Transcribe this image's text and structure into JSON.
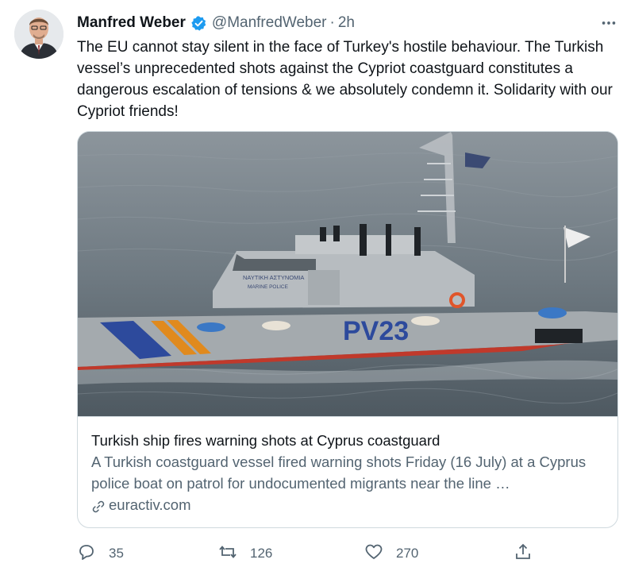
{
  "author": {
    "name": "Manfred Weber",
    "handle": "@ManfredWeber",
    "separator": "·",
    "time": "2h"
  },
  "tweet": {
    "text": "The EU cannot stay silent in the face of Turkey's hostile behaviour. The Turkish vessel’s unprecedented shots against the Cypriot coastguard constitutes a dangerous escalation of tensions & we absolutely condemn it. Solidarity with our Cypriot friends!"
  },
  "card": {
    "title": "Turkish ship fires warning shots at Cyprus coastguard",
    "description": "A Turkish coastguard vessel fired warning shots Friday (16 July) at a Cyprus police boat on patrol for undocumented migrants near the line …",
    "domain": "euractiv.com",
    "image": {
      "hull_text": "PV23",
      "cabin_text_1": "ΝΑΥΤΙΚΗ ΑΣΤΥΝΟΜΙΑ",
      "cabin_text_2": "MARINE POLICE"
    }
  },
  "actions": {
    "replies": "35",
    "retweets": "126",
    "likes": "270"
  },
  "colors": {
    "verified": "#1d9bf0",
    "text_secondary": "#536471",
    "border": "#cfd9de"
  },
  "icons": [
    "verified-badge-icon",
    "more-icon",
    "link-icon",
    "reply-icon",
    "retweet-icon",
    "like-icon",
    "share-icon"
  ]
}
